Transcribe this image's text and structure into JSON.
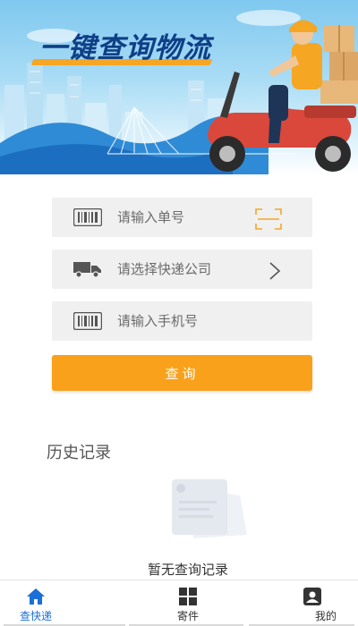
{
  "banner": {
    "title": "一键查询物流"
  },
  "form": {
    "tracking_placeholder": "请输入单号",
    "company_placeholder": "请选择快递公司",
    "phone_placeholder": "请输入手机号",
    "query_label": "查询"
  },
  "history": {
    "title": "历史记录",
    "empty_text": "暂无查询记录"
  },
  "nav": {
    "items": [
      {
        "label": "查快递",
        "icon": "home-icon",
        "active": true
      },
      {
        "label": "寄件",
        "icon": "grid-icon",
        "active": false
      },
      {
        "label": "我的",
        "icon": "profile-icon",
        "active": false
      }
    ]
  },
  "colors": {
    "accent": "#f9a11b",
    "nav_active": "#1a6fd8",
    "title_blue": "#0f3f87"
  }
}
